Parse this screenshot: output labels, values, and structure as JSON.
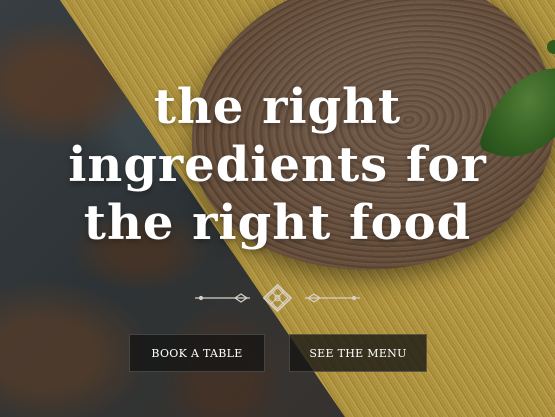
{
  "hero": {
    "headline_lines": [
      "the right",
      "ingredients for",
      "the right food"
    ]
  },
  "buttons": {
    "book": "BOOK A TABLE",
    "menu": "SEE THE MENU"
  },
  "colors": {
    "text": "#ffffff",
    "button_bg": "#141414",
    "divider": "#d8d0c4"
  },
  "icons": {
    "divider": "ornamental-knot-icon"
  }
}
